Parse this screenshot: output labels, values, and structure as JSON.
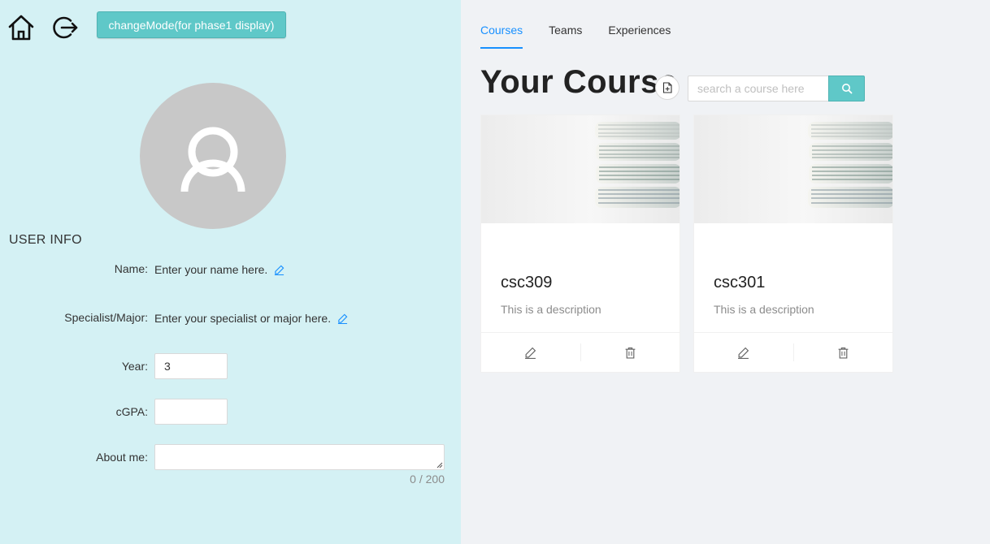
{
  "left_panel": {
    "mode_button_label": "changeMode(for phase1 display)",
    "section_title": "USER INFO",
    "fields": {
      "name": {
        "label": "Name:",
        "value": "Enter your name here."
      },
      "major": {
        "label": "Specialist/Major:",
        "value": "Enter your specialist or major here."
      },
      "year": {
        "label": "Year:",
        "value": "3"
      },
      "cgpa": {
        "label": "cGPA:",
        "value": ""
      },
      "about": {
        "label": "About me:",
        "value": "",
        "counter": "0 / 200"
      }
    }
  },
  "right_panel": {
    "tabs": [
      {
        "label": "Courses",
        "active": true
      },
      {
        "label": "Teams",
        "active": false
      },
      {
        "label": "Experiences",
        "active": false
      }
    ],
    "page_title": "Your Course",
    "search": {
      "placeholder": "search a course here"
    },
    "courses": [
      {
        "title": "csc309",
        "description": "This is a description"
      },
      {
        "title": "csc301",
        "description": "This is a description"
      }
    ]
  },
  "colors": {
    "left_background": "#d4f1f4",
    "right_background": "#f0f2f5",
    "accent_teal": "#5fc8c8",
    "active_tab": "#1890ff"
  },
  "icons": [
    "home-icon",
    "logout-icon",
    "user-icon",
    "edit-icon",
    "add-file-icon",
    "search-icon",
    "delete-icon"
  ]
}
